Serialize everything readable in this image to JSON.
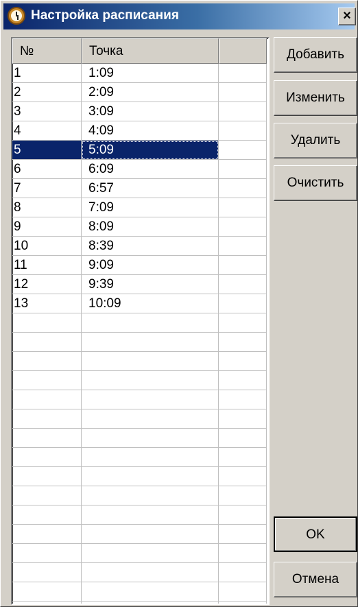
{
  "window": {
    "title": "Настройка расписания",
    "close_label": "×"
  },
  "grid": {
    "columns": [
      "№",
      "Точка",
      ""
    ],
    "rows": [
      {
        "num": "1",
        "point": "1:09"
      },
      {
        "num": "2",
        "point": "2:09"
      },
      {
        "num": "3",
        "point": "3:09"
      },
      {
        "num": "4",
        "point": "4:09"
      },
      {
        "num": "5",
        "point": "5:09",
        "selected": true
      },
      {
        "num": "6",
        "point": "6:09"
      },
      {
        "num": "7",
        "point": "6:57"
      },
      {
        "num": "8",
        "point": "7:09"
      },
      {
        "num": "9",
        "point": "8:09"
      },
      {
        "num": "10",
        "point": "8:39"
      },
      {
        "num": "11",
        "point": "9:09"
      },
      {
        "num": "12",
        "point": "9:39"
      },
      {
        "num": "13",
        "point": "10:09"
      },
      {
        "num": "",
        "point": ""
      },
      {
        "num": "",
        "point": ""
      },
      {
        "num": "",
        "point": ""
      },
      {
        "num": "",
        "point": ""
      },
      {
        "num": "",
        "point": ""
      },
      {
        "num": "",
        "point": ""
      },
      {
        "num": "",
        "point": ""
      },
      {
        "num": "",
        "point": ""
      },
      {
        "num": "",
        "point": ""
      },
      {
        "num": "",
        "point": ""
      },
      {
        "num": "",
        "point": ""
      },
      {
        "num": "",
        "point": ""
      },
      {
        "num": "",
        "point": ""
      },
      {
        "num": "",
        "point": ""
      },
      {
        "num": "",
        "point": ""
      },
      {
        "num": "",
        "point": ""
      }
    ]
  },
  "buttons": {
    "add": "Добавить",
    "edit": "Изменить",
    "delete": "Удалить",
    "clear": "Очистить",
    "ok": "OK",
    "cancel": "Отмена"
  },
  "colors": {
    "titlebar": "#0a246a",
    "selection": "#0a246a",
    "face": "#d4d0c8"
  },
  "icons": {
    "app": "clock-icon",
    "close": "close-icon"
  }
}
